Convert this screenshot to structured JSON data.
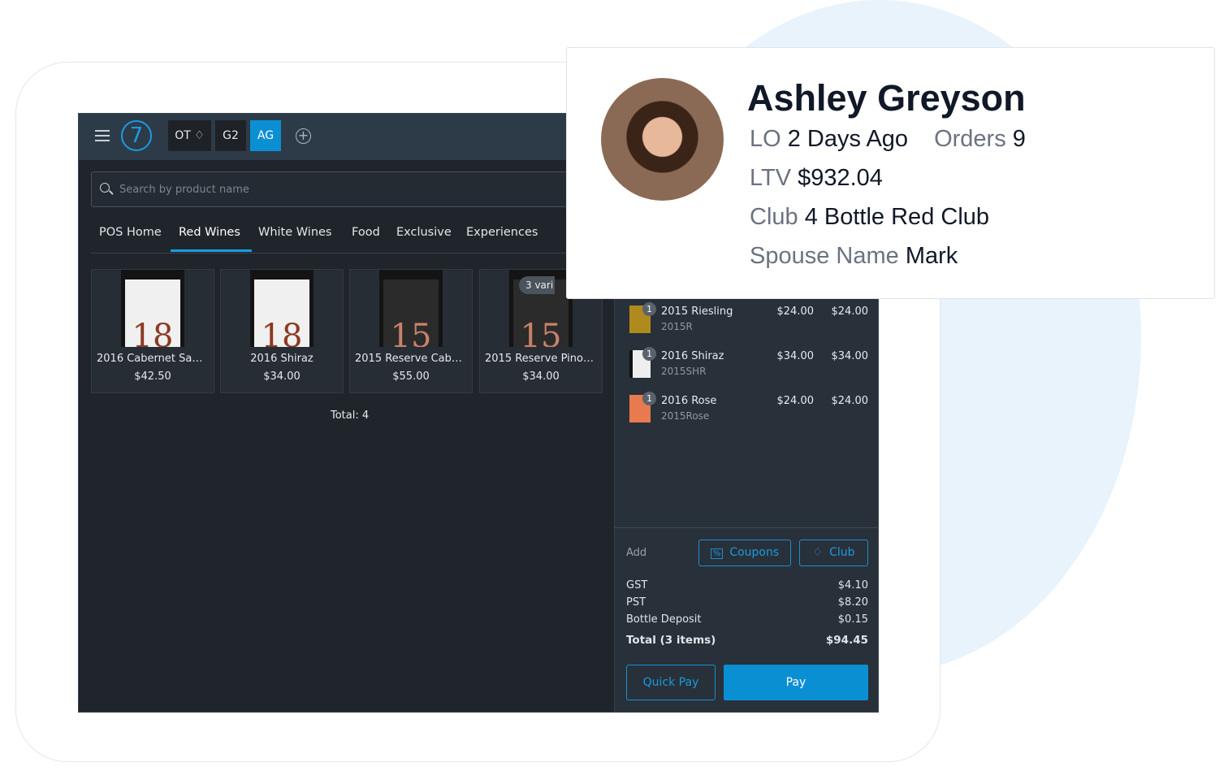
{
  "header": {
    "tabs": [
      {
        "label": "OT",
        "icon": "diamond-icon"
      },
      {
        "label": "G2"
      },
      {
        "label": "AG",
        "active": true
      }
    ],
    "logo": "7",
    "accent": "#1a9be0"
  },
  "search": {
    "placeholder": "Search by product name",
    "value": ""
  },
  "nav": {
    "tabs": [
      "POS Home",
      "Red Wines",
      "White Wines",
      "Food",
      "Exclusive",
      "Experiences"
    ],
    "active": "Red Wines"
  },
  "products": [
    {
      "name": "2016 Cabernet Sauv...",
      "price": "$42.50",
      "label": "18"
    },
    {
      "name": "2016 Shiraz",
      "price": "$34.00",
      "label": "18"
    },
    {
      "name": "2015 Reserve Caber...",
      "price": "$55.00",
      "label": "15"
    },
    {
      "name": "2015 Reserve Pinot ...",
      "price": "$34.00",
      "label": "15",
      "badge": "3 vari"
    }
  ],
  "total_label": "Total: 4",
  "cart": {
    "items": [
      {
        "qty": "1",
        "name": "2015 Riesling",
        "sku": "2015R",
        "price": "$24.00",
        "total": "$24.00",
        "color": "#b08a1c"
      },
      {
        "qty": "1",
        "name": "2016 Shiraz",
        "sku": "2015SHR",
        "price": "$34.00",
        "total": "$34.00",
        "color": "#eeeeee"
      },
      {
        "qty": "1",
        "name": "2016 Rose",
        "sku": "2015Rose",
        "price": "$24.00",
        "total": "$24.00",
        "color": "#e87a50"
      }
    ],
    "add_label": "Add",
    "coupons_label": "Coupons",
    "club_label": "Club",
    "summary": [
      {
        "label": "GST",
        "value": "$4.10"
      },
      {
        "label": "PST",
        "value": "$8.20"
      },
      {
        "label": "Bottle Deposit",
        "value": "$0.15"
      }
    ],
    "total": {
      "label": "Total (3 items)",
      "value": "$94.45"
    },
    "quick_pay_label": "Quick Pay",
    "pay_label": "Pay"
  },
  "customer": {
    "name": "Ashley Greyson",
    "lo_label": "LO",
    "lo_value": "2 Days Ago",
    "orders_label": "Orders",
    "orders_value": "9",
    "ltv_label": "LTV",
    "ltv_value": "$932.04",
    "club_label": "Club",
    "club_value": "4 Bottle Red Club",
    "spouse_label": "Spouse Name",
    "spouse_value": "Mark"
  }
}
